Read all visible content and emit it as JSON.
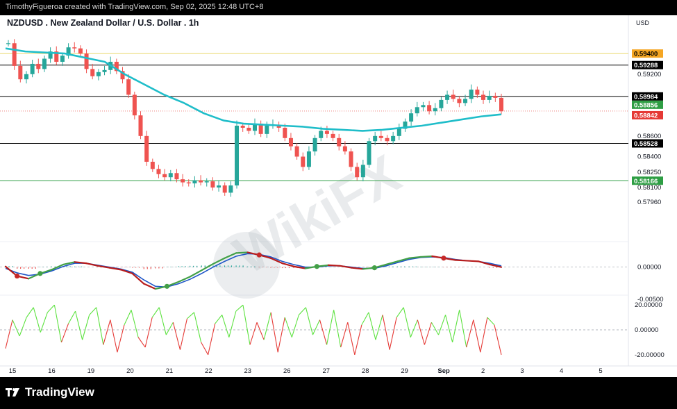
{
  "header": {
    "credit": "TimothyFigueroa created with TradingView.com, Sep 02, 2025 12:48 UTC+8"
  },
  "chart_data": {
    "type": "candlestick",
    "title": "NZDUSD . New Zealand Dollar / U.S. Dollar . 1h",
    "currency": "USD",
    "price_axis": {
      "ticks": [
        "0.59200",
        "0.58600",
        "0.58400",
        "0.58250",
        "0.58100",
        "0.57960"
      ],
      "ylim": [
        0.5775,
        0.5965
      ]
    },
    "x_labels": [
      "15",
      "16",
      "19",
      "20",
      "21",
      "22",
      "23",
      "26",
      "27",
      "28",
      "29",
      "Sep",
      "2",
      "3",
      "4",
      "5"
    ],
    "horizontal_levels": [
      {
        "value": 0.594,
        "label": "0.59400",
        "color": "#f5a623",
        "line": "#e9d66b"
      },
      {
        "value": 0.59288,
        "label": "0.59288",
        "color": "#000000",
        "line": "#000000"
      },
      {
        "value": 0.58984,
        "label": "0.58984",
        "color": "#000000",
        "line": "#000000"
      },
      {
        "value": 0.58528,
        "label": "0.58528",
        "color": "#000000",
        "line": "#000000"
      },
      {
        "value": 0.58166,
        "label": "0.58166",
        "color": "#2e9e44",
        "line": "#2e9e44"
      }
    ],
    "price_tags": [
      {
        "value": 0.58856,
        "label": "0.58856",
        "color": "#2e9e44"
      },
      {
        "value": 0.58842,
        "label": "0.58842",
        "color": "#e53935"
      }
    ],
    "close_series": [
      0.595,
      0.5928,
      0.5915,
      0.592,
      0.593,
      0.5925,
      0.5935,
      0.5942,
      0.5932,
      0.5938,
      0.5946,
      0.5945,
      0.594,
      0.5925,
      0.5918,
      0.5922,
      0.5924,
      0.5932,
      0.5923,
      0.5915,
      0.59,
      0.588,
      0.586,
      0.5835,
      0.5828,
      0.5823,
      0.582,
      0.5824,
      0.5818,
      0.5815,
      0.5814,
      0.5817,
      0.5815,
      0.5816,
      0.581,
      0.5812,
      0.5805,
      0.5812,
      0.587,
      0.5868,
      0.5865,
      0.5872,
      0.5862,
      0.587,
      0.5871,
      0.5868,
      0.5858,
      0.585,
      0.584,
      0.583,
      0.5845,
      0.5858,
      0.5865,
      0.5862,
      0.5858,
      0.585,
      0.5845,
      0.583,
      0.582,
      0.5832,
      0.5855,
      0.586,
      0.5858,
      0.5855,
      0.586,
      0.5867,
      0.5874,
      0.5882,
      0.5888,
      0.589,
      0.5884,
      0.5887,
      0.5895,
      0.59,
      0.5896,
      0.5892,
      0.5896,
      0.5905,
      0.59,
      0.5895,
      0.5899,
      0.5897,
      0.5884
    ],
    "ma_series": [
      0.5945,
      0.5942,
      0.5941,
      0.594,
      0.5936,
      0.5932,
      0.592,
      0.591,
      0.59,
      0.5892,
      0.5882,
      0.5875,
      0.5872,
      0.5871,
      0.587,
      0.5869,
      0.5867,
      0.5866,
      0.5865,
      0.5866,
      0.5868,
      0.587,
      0.5873,
      0.5876,
      0.5879,
      0.5881
    ],
    "macd": {
      "ticks": [
        "0.00000",
        "-0.00500"
      ],
      "ylim": [
        -0.006,
        0.003
      ],
      "macd_line": [
        0.0001,
        -0.0014,
        -0.0018,
        -0.001,
        -0.0004,
        0.0004,
        0.0008,
        0.0006,
        0.0002,
        -0.0001,
        -0.0004,
        -0.001,
        -0.0026,
        -0.0034,
        -0.003,
        -0.0023,
        -0.0015,
        -0.0005,
        0.0005,
        0.0014,
        0.0022,
        0.0023,
        0.0019,
        0.0014,
        0.0006,
        0.0001,
        -0.0002,
        0.0001,
        0.0003,
        0.0002,
        -0.0001,
        -0.0003,
        -0.0001,
        0.0004,
        0.0009,
        0.0014,
        0.0016,
        0.0017,
        0.0014,
        0.0011,
        0.001,
        0.0009,
        0.0004,
        0.0
      ],
      "signal_line": [
        -0.0002,
        -0.0009,
        -0.0013,
        -0.0011,
        -0.0006,
        0.0001,
        0.0006,
        0.0006,
        0.0003,
        0.0,
        -0.0003,
        -0.0008,
        -0.002,
        -0.003,
        -0.0031,
        -0.0026,
        -0.0019,
        -0.001,
        0.0,
        0.0009,
        0.0017,
        0.0021,
        0.002,
        0.0016,
        0.0009,
        0.0004,
        0.0,
        0.0,
        0.0002,
        0.0002,
        0.0,
        -0.0002,
        -0.0002,
        0.0002,
        0.0007,
        0.0012,
        0.0015,
        0.0016,
        0.0015,
        0.0012,
        0.001,
        0.0009,
        0.0006,
        0.0002
      ]
    },
    "rsi": {
      "ticks": [
        "20.00000",
        "0.00000",
        "-20.00000"
      ],
      "ylim": [
        -24,
        24
      ],
      "values": [
        -15,
        8,
        -5,
        10,
        18,
        -2,
        14,
        20,
        -10,
        5,
        15,
        -8,
        12,
        18,
        -12,
        8,
        -18,
        4,
        16,
        -6,
        -14,
        10,
        18,
        -4,
        6,
        -16,
        9,
        14,
        -10,
        -20,
        5,
        12,
        -6,
        15,
        20,
        -12,
        6,
        -8,
        14,
        -18,
        10,
        -6,
        12,
        18,
        -4,
        8,
        -12,
        16,
        -14,
        6,
        -20,
        4,
        14,
        -8,
        12,
        -16,
        10,
        18,
        -6,
        8,
        -12,
        6,
        -4,
        12,
        -10,
        16,
        -14,
        8,
        -18,
        10,
        4,
        -20
      ]
    },
    "watermark": "WikiFX"
  },
  "footer": {
    "brand": "TradingView"
  },
  "colors": {
    "bull": "#26a69a",
    "bear": "#ef5350",
    "ma": "#1fbdc9",
    "macd_green": "#43a047",
    "macd_red": "#b71c1c",
    "macd_blue": "#1e56c7",
    "rsi_green": "#5ce23f",
    "rsi_red": "#e53935"
  }
}
